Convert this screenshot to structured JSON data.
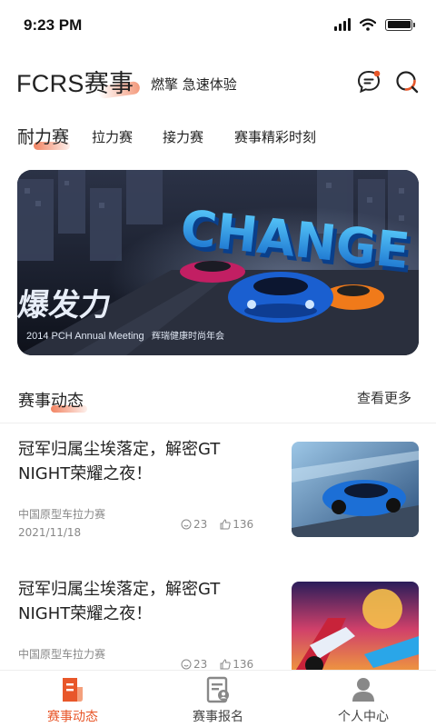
{
  "status_bar": {
    "time": "9:23 PM"
  },
  "header": {
    "brand": "FCRS赛事",
    "tagline": "燃擎 急速体验"
  },
  "tabs": [
    {
      "label": "耐力赛",
      "active": true
    },
    {
      "label": "拉力赛",
      "active": false
    },
    {
      "label": "接力赛",
      "active": false
    },
    {
      "label": "赛事精彩时刻",
      "active": false
    }
  ],
  "banner": {
    "headline": "CHANGE",
    "logo_text": "爆发力",
    "subline": "2014 PCH Annual Meeting",
    "subline2": "辉瑞健康时尚年会"
  },
  "section": {
    "title": "赛事动态",
    "more_label": "查看更多"
  },
  "news": [
    {
      "title": "冠军归属尘埃落定，解密GT NIGHT荣耀之夜！",
      "source": "中国原型车拉力赛",
      "date": "2021/11/18",
      "comments": "23",
      "likes": "136"
    },
    {
      "title": "冠军归属尘埃落定，解密GT NIGHT荣耀之夜！",
      "source": "中国原型车拉力赛",
      "date": "",
      "comments": "23",
      "likes": "136"
    }
  ],
  "bottom_nav": [
    {
      "label": "赛事动态",
      "active": true
    },
    {
      "label": "赛事报名",
      "active": false
    },
    {
      "label": "个人中心",
      "active": false
    }
  ],
  "colors": {
    "accent": "#e8572a",
    "text": "#222222",
    "muted": "#888888"
  }
}
